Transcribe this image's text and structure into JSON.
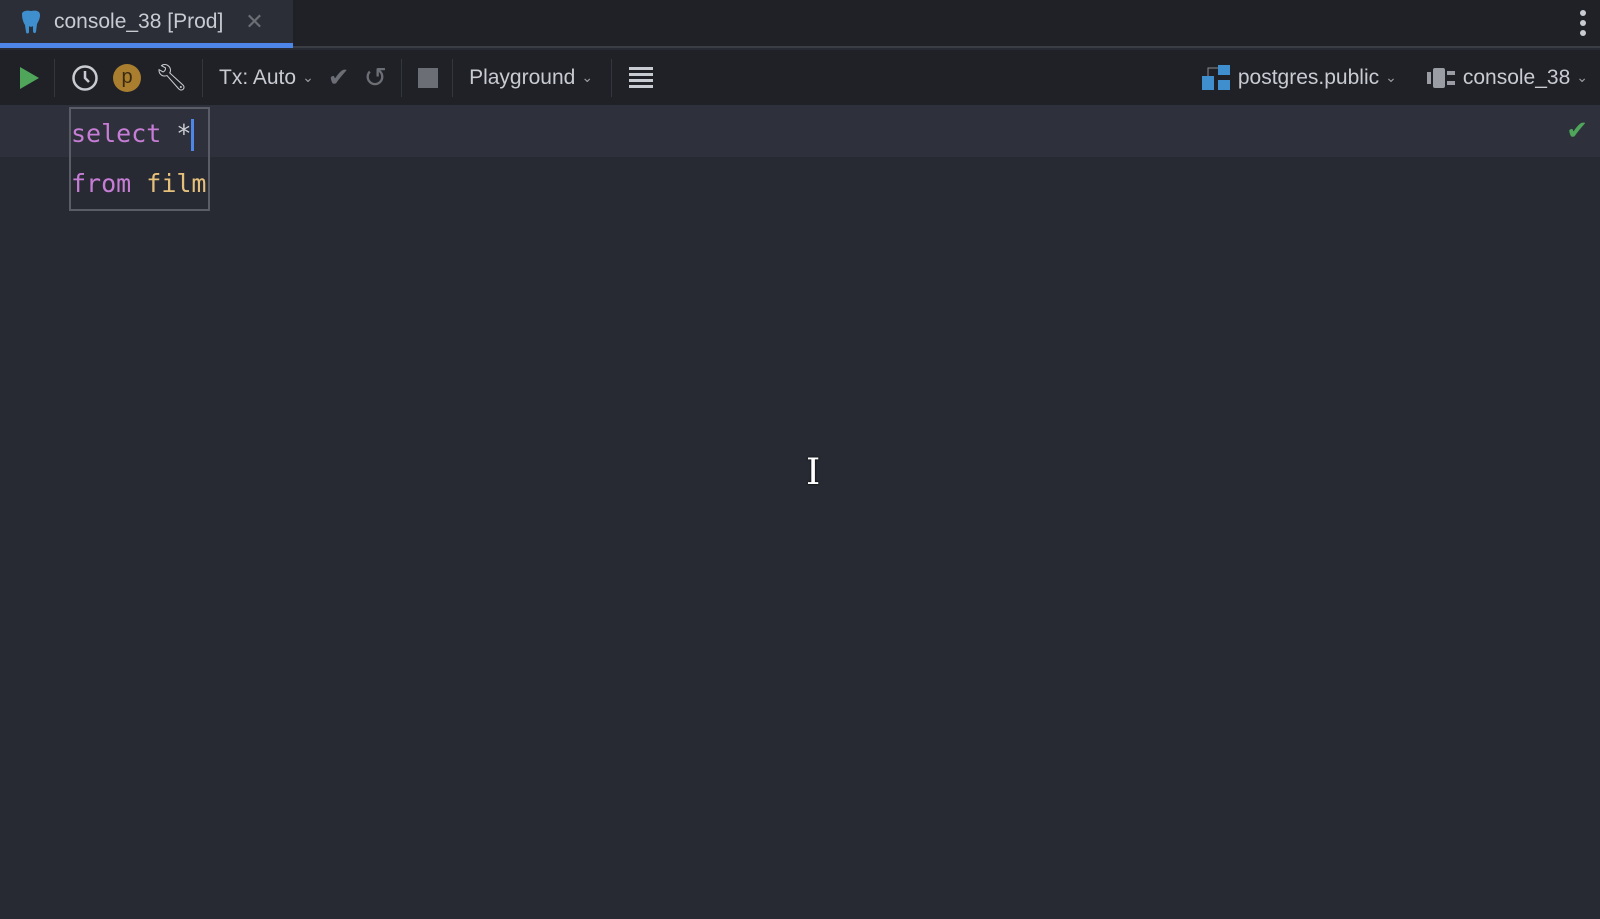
{
  "tab": {
    "title": "console_38 [Prod]",
    "icon": "postgresql-elephant-icon"
  },
  "toolbar": {
    "tx_label": "Tx: Auto",
    "profile_badge": "p",
    "mode_label": "Playground",
    "schema_label": "postgres.public",
    "session_label": "console_38"
  },
  "editor": {
    "line1_keyword": "select",
    "line1_rest": " *",
    "line2_keyword": "from",
    "line2_table": "film"
  },
  "status": {
    "check": "✔"
  },
  "colors": {
    "accent": "#4d86e8",
    "keyword": "#c77dd6",
    "identifier": "#e6c07b",
    "run": "#4fa65a"
  }
}
